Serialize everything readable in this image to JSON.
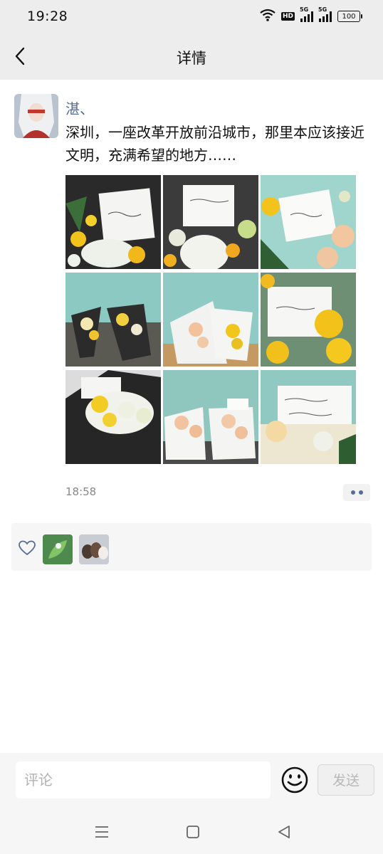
{
  "status_bar": {
    "time": "19:28",
    "hd_badge": "HD",
    "net1": "5G",
    "net2": "5G",
    "battery": "100",
    "icons": [
      "wifi-icon",
      "hd-icon",
      "signal-icon",
      "signal-icon",
      "battery-icon"
    ]
  },
  "header": {
    "title": "详情",
    "back_icon": "chevron-left-icon"
  },
  "post": {
    "username": "湛、",
    "text": "深圳，一座改革开放前沿城市，那里本应该接近文明，充满希望的地方……",
    "time": "18:58",
    "more_icon": "more-dots-icon",
    "photos": [
      {
        "caption": ""
      },
      {
        "caption": ""
      },
      {
        "caption": ""
      },
      {
        "caption": ""
      },
      {
        "caption": ""
      },
      {
        "caption": ""
      },
      {
        "caption": ""
      },
      {
        "caption": ""
      },
      {
        "caption": ""
      }
    ]
  },
  "likes": {
    "icon": "heart-icon",
    "likers": [
      {
        "name": ""
      },
      {
        "name": ""
      }
    ]
  },
  "comment_bar": {
    "placeholder": "评论",
    "emoji_icon": "smiley-icon",
    "send_label": "发送"
  },
  "nav_bar": {
    "icons": [
      "menu-icon",
      "home-square-icon",
      "back-triangle-icon"
    ]
  },
  "colors": {
    "accent_link": "#576b95",
    "header_bg": "#ededed",
    "panel_bg": "#f6f6f6"
  }
}
